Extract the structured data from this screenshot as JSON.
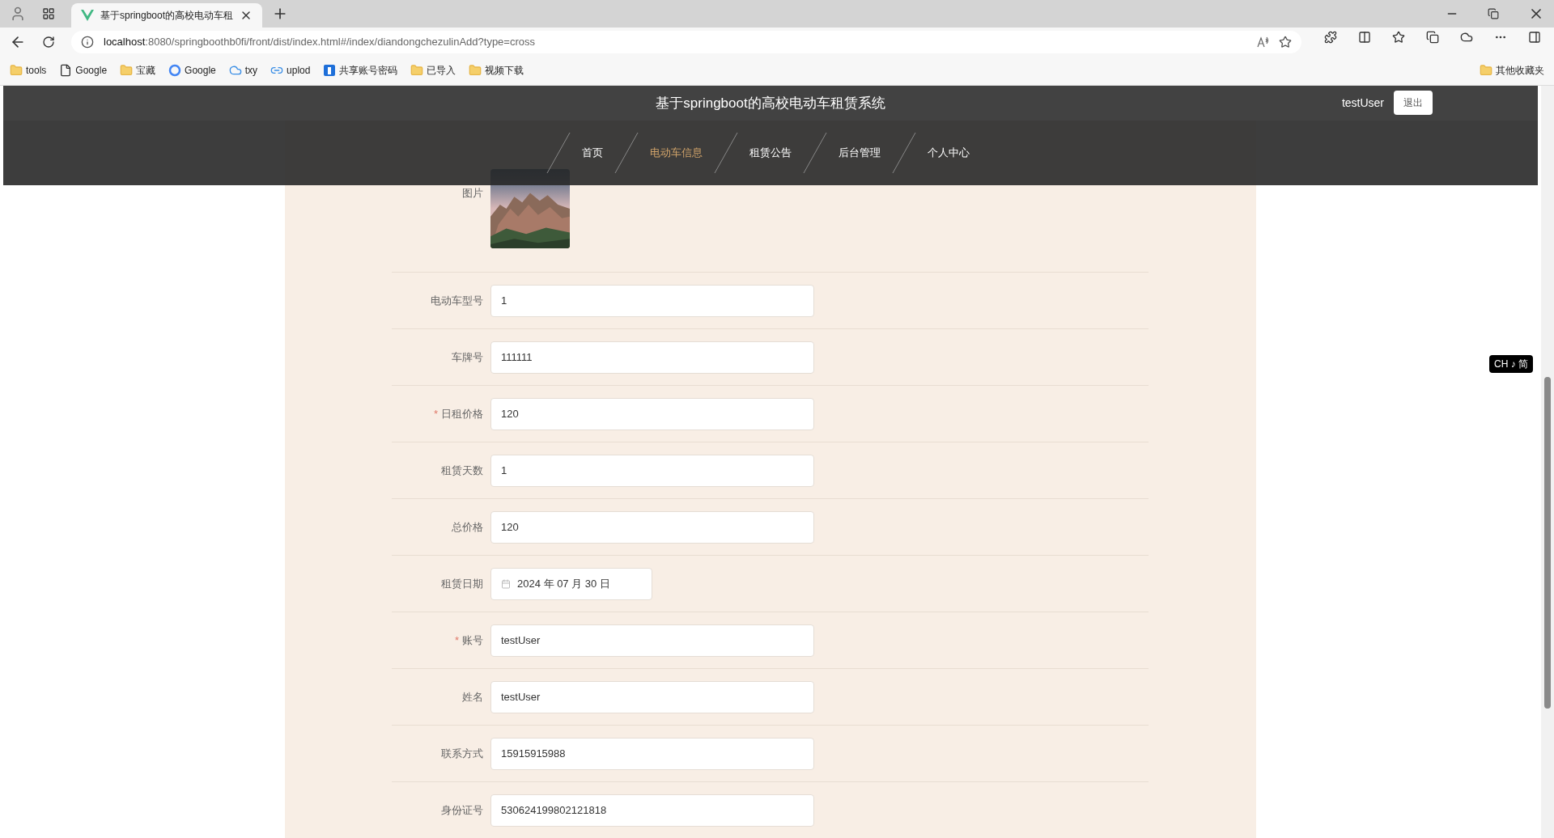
{
  "browser": {
    "tab_title": "基于springboot的高校电动车租",
    "url_host": "localhost",
    "url_rest": ":8080/springboothb0fi/front/dist/index.html#/index/diandongchezulinAdd?type=cross",
    "bookmarks": [
      {
        "label": "tools",
        "kind": "folder"
      },
      {
        "label": "Google",
        "kind": "page"
      },
      {
        "label": "宝藏",
        "kind": "folder"
      },
      {
        "label": "Google",
        "kind": "google"
      },
      {
        "label": "txy",
        "kind": "cloud"
      },
      {
        "label": "uplod",
        "kind": "link"
      },
      {
        "label": "共享账号密码",
        "kind": "app"
      },
      {
        "label": "已导入",
        "kind": "folder"
      },
      {
        "label": "视频下载",
        "kind": "folder"
      }
    ],
    "other_bookmarks": "其他收藏夹"
  },
  "header": {
    "title": "基于springboot的高校电动车租赁系统",
    "user": "testUser",
    "logout": "退出"
  },
  "nav": [
    {
      "label": "首页",
      "selected": false
    },
    {
      "label": "电动车信息",
      "selected": true
    },
    {
      "label": "租赁公告",
      "selected": false
    },
    {
      "label": "后台管理",
      "selected": false
    },
    {
      "label": "个人中心",
      "selected": false
    }
  ],
  "form": {
    "image_label": "图片",
    "fields": [
      {
        "label": "电动车型号",
        "value": "1",
        "kind": "text"
      },
      {
        "label": "车牌号",
        "value": "111111",
        "kind": "text"
      },
      {
        "label": "日租价格",
        "value": "120",
        "kind": "text",
        "required_mark": "*"
      },
      {
        "label": "租赁天数",
        "value": "1",
        "kind": "text"
      },
      {
        "label": "总价格",
        "value": "120",
        "kind": "text"
      },
      {
        "label": "租赁日期",
        "value": "2024 年 07 月 30 日",
        "kind": "date"
      },
      {
        "label": "账号",
        "value": "testUser",
        "kind": "text",
        "required_mark": "*"
      },
      {
        "label": "姓名",
        "value": "testUser",
        "kind": "text"
      },
      {
        "label": "联系方式",
        "value": "15915915988",
        "kind": "text"
      },
      {
        "label": "身份证号",
        "value": "530624199802121818",
        "kind": "text"
      }
    ]
  },
  "ime_indicator": "CH ♪ 简"
}
